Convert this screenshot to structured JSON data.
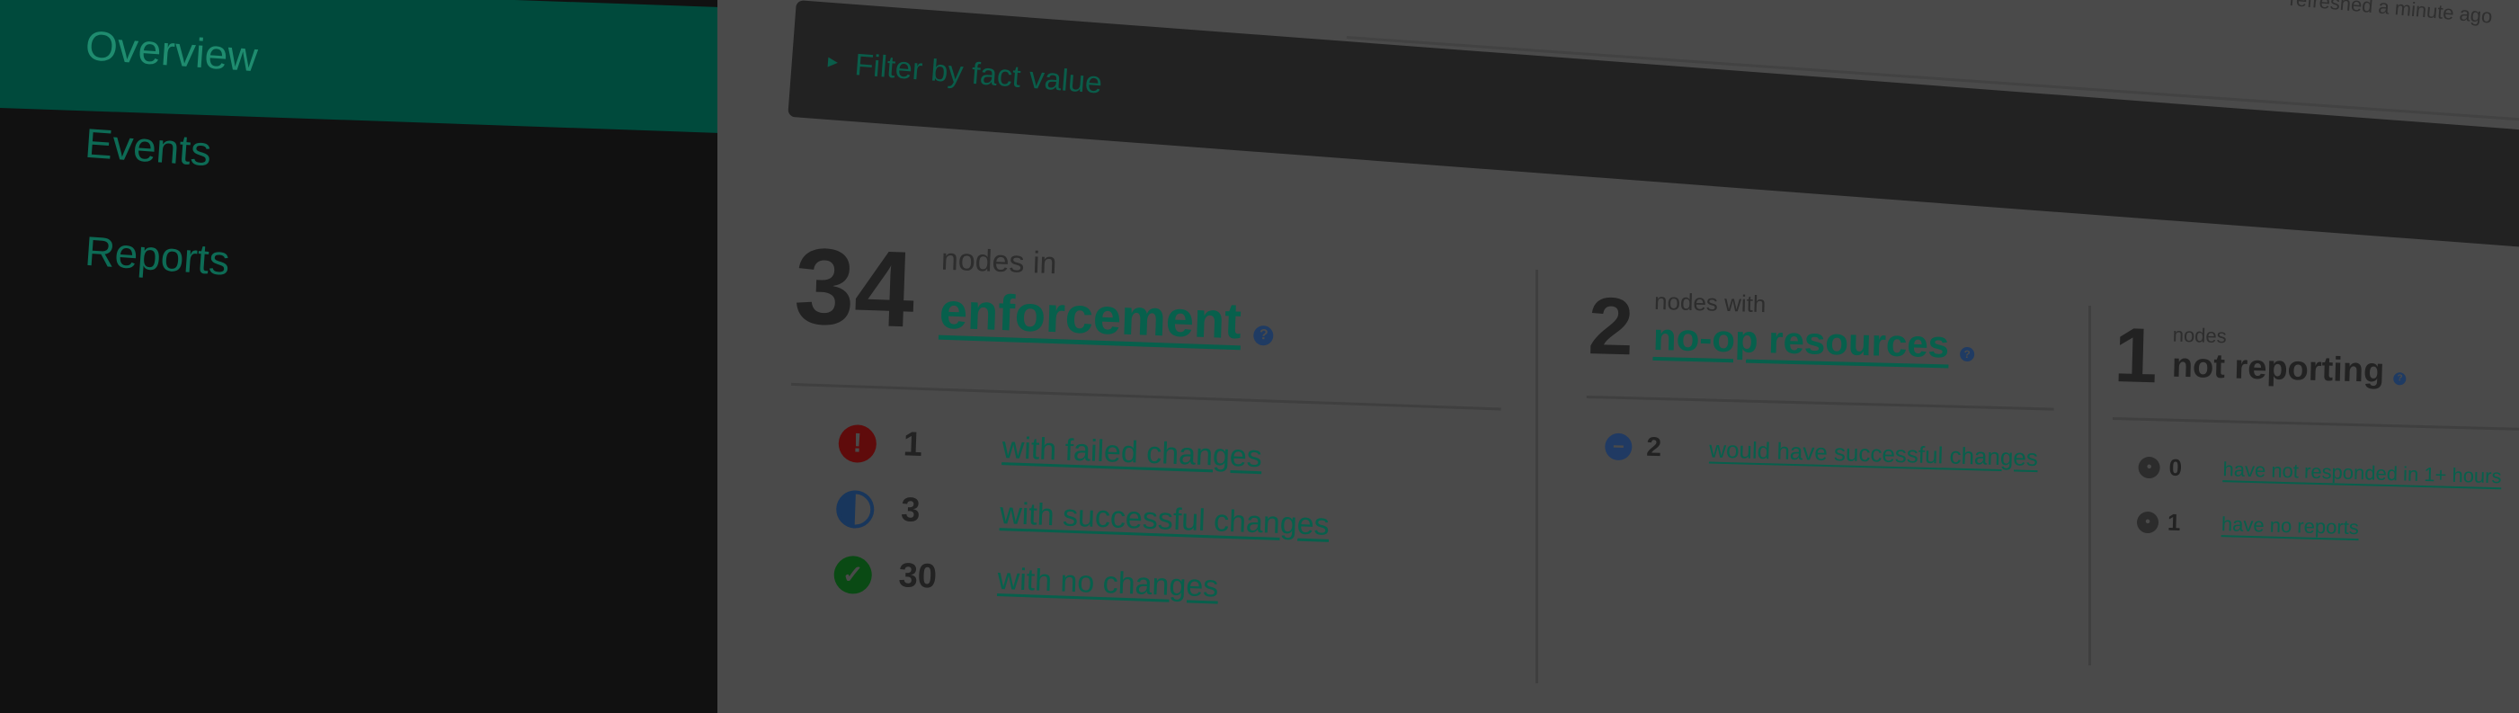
{
  "sidebar": {
    "items": [
      {
        "label": "Overview",
        "active": true
      },
      {
        "label": "Events",
        "active": false
      },
      {
        "label": "Reports",
        "active": false
      }
    ]
  },
  "header": {
    "note": "refreshed a minute ago"
  },
  "filter": {
    "label": "Filter by fact value",
    "caret_icon": "caret-right-icon"
  },
  "enforcement": {
    "count": "34",
    "subtitle": "nodes in",
    "title": "enforcement",
    "help_icon": "help-icon",
    "rows": [
      {
        "icon": "error-icon",
        "count": "1",
        "label": "with failed changes"
      },
      {
        "icon": "half-circle-icon",
        "count": "3",
        "label": "with successful changes"
      },
      {
        "icon": "check-icon",
        "count": "30",
        "label": "with no changes"
      }
    ]
  },
  "noop": {
    "count": "2",
    "subtitle": "nodes with",
    "title": "no-op resources",
    "help_icon": "help-icon",
    "rows": [
      {
        "icon": "noop-icon",
        "count": "2",
        "label": "would have successful changes"
      }
    ]
  },
  "not_reporting": {
    "count": "1",
    "subtitle": "nodes",
    "title": "not reporting",
    "help_icon": "help-icon",
    "rows": [
      {
        "icon": "unresponsive-icon",
        "count": "0",
        "label": "have not responded in 1+ hours"
      },
      {
        "icon": "no-report-icon",
        "count": "1",
        "label": "have no reports"
      }
    ]
  },
  "colors": {
    "sidebar_bg": "#111111",
    "active_nav_bg": "#004a3c",
    "accent_green": "#07604c",
    "content_bg": "#4a4a4a",
    "filter_bar_bg": "#222222"
  }
}
